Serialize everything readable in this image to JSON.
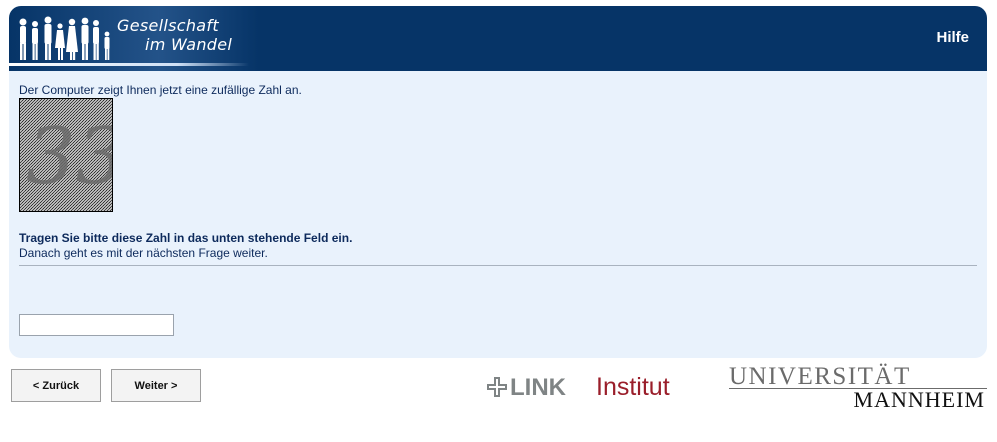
{
  "header": {
    "logo_line1": "Gesellschaft",
    "logo_line2": "im Wandel",
    "help_label": "Hilfe"
  },
  "content": {
    "intro": "Der Computer zeigt Ihnen jetzt eine zufällige Zahl an.",
    "captcha_number": "33",
    "instruction": "Tragen Sie bitte diese Zahl in das unten stehende Feld ein.",
    "subtext": "Danach geht es mit der nächsten Frage weiter.",
    "answer_value": ""
  },
  "navigation": {
    "back_label": "< Zurück",
    "next_label": "Weiter >"
  },
  "footer": {
    "link_word": "LINK",
    "institut_word": "Institut",
    "uni_top": "UNIVERSITÄT",
    "uni_bottom": "MANNHEIM"
  },
  "colors": {
    "header_bg": "#063467",
    "panel_bg": "#e9f2fc",
    "text": "#0d2a5c",
    "institut_red": "#9a1e2a"
  }
}
